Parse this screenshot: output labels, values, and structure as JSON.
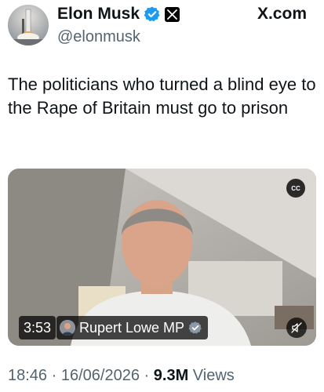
{
  "author": {
    "display_name": "Elon Musk",
    "handle": "@elonmusk"
  },
  "site_label": "X.com",
  "tweet": {
    "text": "The politicians who turned a blind eye to the Rape of Britain must go to prison"
  },
  "video": {
    "duration": "3:53",
    "author_label": "Rupert Lowe MP",
    "cc_label": "CC"
  },
  "meta": {
    "time": "18:46",
    "date": "16/06/2026",
    "views_count": "9.3M",
    "views_label": "Views",
    "separator": "·"
  },
  "colors": {
    "text_primary": "#0f1419",
    "text_secondary": "#536471",
    "verified_blue": "#1d9bf0"
  },
  "icons": {
    "verified": "verified-badge-icon",
    "x_logo": "x-logo-icon",
    "cc": "closed-captions-icon",
    "mute": "speaker-muted-icon"
  }
}
